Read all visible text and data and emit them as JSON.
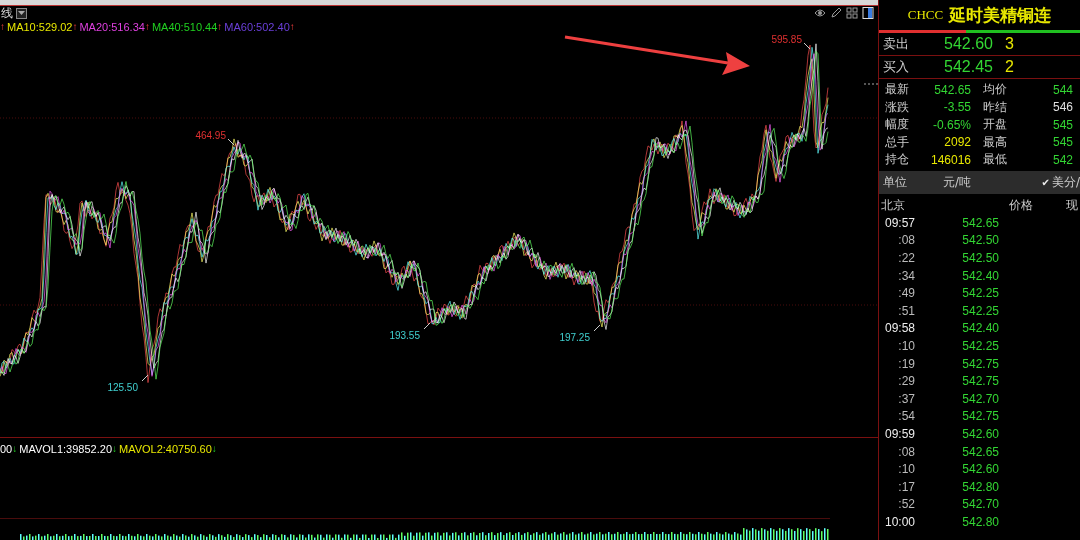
{
  "chart_header": {
    "period": "线"
  },
  "ma_legend": [
    {
      "arrow": "↑"
    },
    {
      "text": "MA10:529.02",
      "color": "#e8e800",
      "arrow": "↑"
    },
    {
      "text": "MA20:516.34",
      "color": "#e040e0",
      "arrow": "↑"
    },
    {
      "text": "MA40:510.44",
      "color": "#20d020",
      "arrow": "↑"
    },
    {
      "text": "MA60:502.40",
      "color": "#6a3fd8",
      "arrow": "↑"
    }
  ],
  "price_labels": [
    {
      "text": "595.85",
      "kind": "high"
    },
    {
      "text": "464.95",
      "kind": "high"
    },
    {
      "text": "125.50",
      "kind": "low"
    },
    {
      "text": "193.55",
      "kind": "low"
    },
    {
      "text": "197.25",
      "kind": "low"
    }
  ],
  "volume_legend": [
    {
      "text": "00",
      "arrow": "↓"
    },
    {
      "text": "MAVOL1:39852.20",
      "color": "#ffffff",
      "arrow": "↓"
    },
    {
      "text": "MAVOL2:40750.60",
      "color": "#e8e800",
      "arrow": "↓"
    }
  ],
  "quote": {
    "symbol": "CHCC",
    "name": "延时美精铜连",
    "orders": [
      {
        "label": "卖出",
        "price": "542.60",
        "volume": "3"
      },
      {
        "label": "买入",
        "price": "542.45",
        "volume": "2"
      }
    ],
    "stats": [
      {
        "left": {
          "label": "最新",
          "value": "542.65",
          "color": "#33d633"
        },
        "right": {
          "label": "均价",
          "value": "544",
          "color": "#33d633"
        }
      },
      {
        "left": {
          "label": "涨跌",
          "value": "-3.55",
          "color": "#33d633"
        },
        "right": {
          "label": "昨结",
          "value": "546",
          "color": "#e0e0e0"
        }
      },
      {
        "left": {
          "label": "幅度",
          "value": "-0.65%",
          "color": "#33d633"
        },
        "right": {
          "label": "开盘",
          "value": "545",
          "color": "#33d633"
        }
      },
      {
        "left": {
          "label": "总手",
          "value": "2092",
          "color": "#e8e800"
        },
        "right": {
          "label": "最高",
          "value": "545",
          "color": "#33d633"
        }
      },
      {
        "left": {
          "label": "持仓",
          "value": "146016",
          "color": "#e8e800"
        },
        "right": {
          "label": "最低",
          "value": "542",
          "color": "#33d633"
        }
      }
    ],
    "unit": {
      "label": "单位",
      "value": "元/吨",
      "check": "✔",
      "option": "美分/"
    }
  },
  "ticks": {
    "columns": [
      "北京",
      "价格",
      "现"
    ],
    "rows": [
      {
        "time": "09:57",
        "kind": "minute",
        "price": "542.65"
      },
      {
        "time": ":08",
        "kind": "second",
        "price": "542.50"
      },
      {
        "time": ":22",
        "kind": "second",
        "price": "542.50"
      },
      {
        "time": ":34",
        "kind": "second",
        "price": "542.40"
      },
      {
        "time": ":49",
        "kind": "second",
        "price": "542.25"
      },
      {
        "time": ":51",
        "kind": "second",
        "price": "542.25"
      },
      {
        "time": "09:58",
        "kind": "minute",
        "price": "542.40"
      },
      {
        "time": ":10",
        "kind": "second",
        "price": "542.25"
      },
      {
        "time": ":19",
        "kind": "second",
        "price": "542.75"
      },
      {
        "time": ":29",
        "kind": "second",
        "price": "542.75"
      },
      {
        "time": ":37",
        "kind": "second",
        "price": "542.70"
      },
      {
        "time": ":54",
        "kind": "second",
        "price": "542.75"
      },
      {
        "time": "09:59",
        "kind": "minute",
        "price": "542.60"
      },
      {
        "time": ":08",
        "kind": "second",
        "price": "542.65"
      },
      {
        "time": ":10",
        "kind": "second",
        "price": "542.60"
      },
      {
        "time": ":17",
        "kind": "second",
        "price": "542.80"
      },
      {
        "time": ":52",
        "kind": "second",
        "price": "542.70"
      },
      {
        "time": "10:00",
        "kind": "minute",
        "price": "542.80"
      }
    ]
  }
}
